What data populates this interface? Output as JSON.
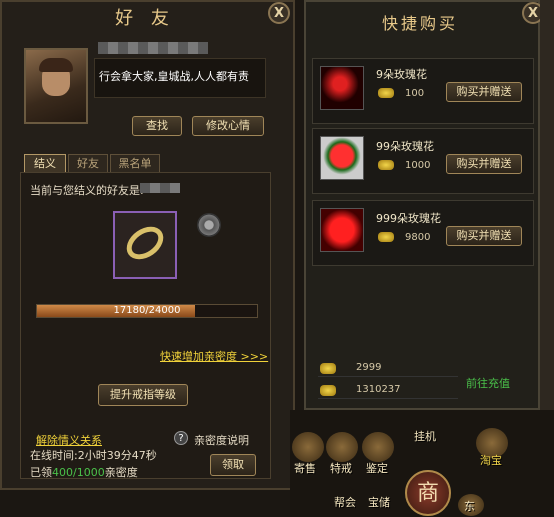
{
  "friend_panel": {
    "title": "好 友",
    "close_label": "X",
    "mood_text": "行会拿大家,皇城战,人人都有责",
    "search_button": "查找",
    "edit_mood_button": "修改心情",
    "tabs": [
      {
        "label": "结义",
        "active": true
      },
      {
        "label": "好友",
        "active": false
      },
      {
        "label": "黑名单",
        "active": false
      }
    ],
    "sworn_label": "当前与您结义的好友是:",
    "intimacy_progress": "17180/24000",
    "intimacy_progress_fraction": 0.716,
    "quick_intimacy_link": "快速增加亲密度 >>>",
    "upgrade_ring_button": "提升戒指等级",
    "dissolve_link": "解除情义关系",
    "help_label": "?",
    "intimacy_help": "亲密度说明",
    "online_time_label": "在线时间:2小时39分47秒",
    "claimed_prefix": "已领",
    "claimed_value": "400/1000",
    "claimed_suffix": "亲密度",
    "claim_button": "领取"
  },
  "shop_panel": {
    "title": "快捷购买",
    "close_label": "X",
    "items": [
      {
        "name": "9朵玫瑰花",
        "price": "100",
        "button": "购买并赠送",
        "icon": "rose-icon"
      },
      {
        "name": "99朵玫瑰花",
        "price": "1000",
        "button": "购买并赠送",
        "icon": "rose-bouquet-icon"
      },
      {
        "name": "999朵玫瑰花",
        "price": "9800",
        "button": "购买并赠送",
        "icon": "rose-heart-icon"
      }
    ],
    "gold_balance": "2999",
    "bound_gold_balance": "1310237",
    "recharge_link": "前往充值"
  },
  "game_bar": {
    "hang_up": "挂机",
    "items": [
      "寄售",
      "特戒",
      "鉴定"
    ],
    "treasure": "淘宝",
    "bottom_items": [
      "帮会",
      "宝储"
    ],
    "shop_button": "商",
    "corner_label": "东"
  },
  "colors": {
    "accent_gold": "#e8c98a",
    "link_yellow": "#f0d23a",
    "recharge_green": "#4ac04a",
    "progress_green": "#4ac04a",
    "ring_slot_border": "#8a5fb5"
  }
}
